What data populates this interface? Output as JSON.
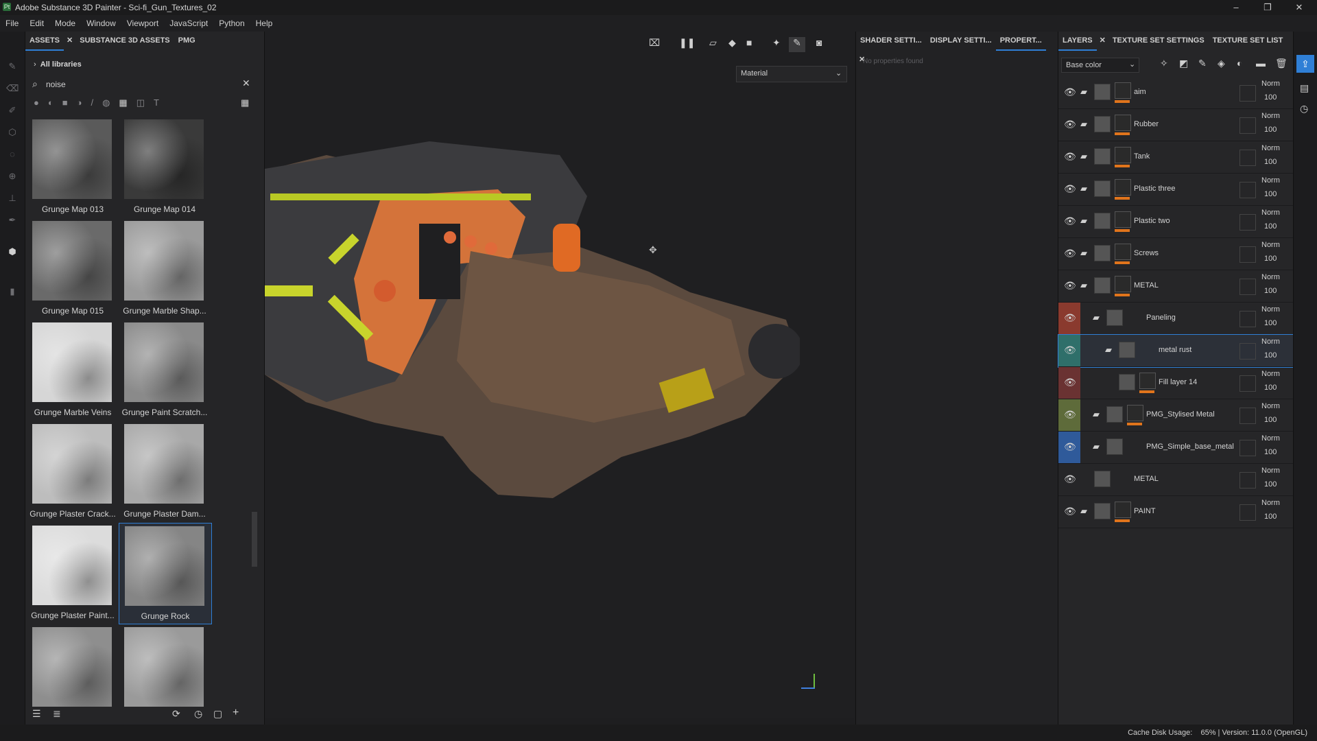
{
  "window": {
    "title": "Adobe Substance 3D Painter - Sci-fi_Gun_Textures_02"
  },
  "menu": [
    "File",
    "Edit",
    "Mode",
    "Window",
    "Viewport",
    "JavaScript",
    "Python",
    "Help"
  ],
  "assets": {
    "tabs": [
      "ASSETS",
      "SUBSTANCE 3D ASSETS",
      "PMG"
    ],
    "breadcrumb": "All libraries",
    "search_value": "noise",
    "items": [
      {
        "label": "Grunge Map 013",
        "shade": "#5a5a5a"
      },
      {
        "label": "Grunge Map 014",
        "shade": "#3a3a3a"
      },
      {
        "label": "Grunge Map 015",
        "shade": "#6a6a6a"
      },
      {
        "label": "Grunge Marble Shap...",
        "shade": "#9a9a9a"
      },
      {
        "label": "Grunge Marble Veins",
        "shade": "#d6d6d6"
      },
      {
        "label": "Grunge Paint Scratch...",
        "shade": "#8a8a8a"
      },
      {
        "label": "Grunge Plaster Crack...",
        "shade": "#bdbdbd"
      },
      {
        "label": "Grunge Plaster Dam...",
        "shade": "#a8a8a8"
      },
      {
        "label": "Grunge Plaster Paint...",
        "shade": "#dcdcdc"
      },
      {
        "label": "Grunge Rock",
        "shade": "#858585",
        "selected": true
      },
      {
        "label": "",
        "shade": "#8e8e8e"
      },
      {
        "label": "",
        "shade": "#9a9a9a"
      }
    ]
  },
  "viewport": {
    "material_dropdown": "Material"
  },
  "properties": {
    "tabs": [
      "SHADER SETTI...",
      "DISPLAY SETTI...",
      "PROPERT..."
    ],
    "empty_text": "No properties found"
  },
  "layers": {
    "tabs": [
      "LAYERS",
      "TEXTURE SET SETTINGS",
      "TEXTURE SET LIST"
    ],
    "channel": "Base color",
    "rows": [
      {
        "name": "aim",
        "blend": "Norm",
        "opacity": "100",
        "color": ""
      },
      {
        "name": "Rubber",
        "blend": "Norm",
        "opacity": "100",
        "color": ""
      },
      {
        "name": "Tank",
        "blend": "Norm",
        "opacity": "100",
        "color": ""
      },
      {
        "name": "Plastic three",
        "blend": "Norm",
        "opacity": "100",
        "color": ""
      },
      {
        "name": "Plastic two",
        "blend": "Norm",
        "opacity": "100",
        "color": ""
      },
      {
        "name": "Screws",
        "blend": "Norm",
        "opacity": "100",
        "color": ""
      },
      {
        "name": "METAL",
        "blend": "Norm",
        "opacity": "100",
        "color": ""
      },
      {
        "name": "Paneling",
        "blend": "Norm",
        "opacity": "100",
        "color": "#8a3a2e"
      },
      {
        "name": "metal rust",
        "blend": "Norm",
        "opacity": "100",
        "color": "#2f6f6a",
        "selected": true
      },
      {
        "name": "Fill layer 14",
        "blend": "Norm",
        "opacity": "100",
        "color": "#6a3232"
      },
      {
        "name": "PMG_Stylised Metal",
        "blend": "Norm",
        "opacity": "100",
        "color": "#5e6b3a"
      },
      {
        "name": "PMG_Simple_base_metal",
        "blend": "Norm",
        "opacity": "100",
        "color": "#2f5a9a"
      },
      {
        "name": "METAL",
        "blend": "Norm",
        "opacity": "100",
        "color": ""
      },
      {
        "name": "PAINT",
        "blend": "Norm",
        "opacity": "100",
        "color": ""
      }
    ]
  },
  "status": {
    "text": "Cache Disk Usage:    65% | Version: 11.0.0 (OpenGL)"
  }
}
